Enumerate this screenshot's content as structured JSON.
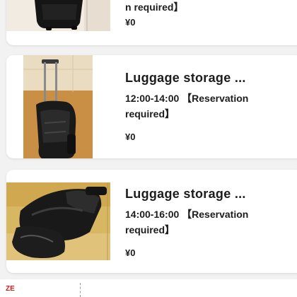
{
  "listings": [
    {
      "tail_text": "n required】",
      "price": "¥0"
    },
    {
      "title": "Luggage storage ...",
      "time": "12:00-14:00 【Reservation required】",
      "price": "¥0"
    },
    {
      "title": "Luggage storage ...",
      "time": "14:00-16:00 【Reservation required】",
      "price": "¥0"
    }
  ],
  "next_listing": {
    "logo_text": "ZE"
  },
  "colors": {
    "card": "#ffffff",
    "background": "#f2f2f2",
    "text": "#1c1c1c",
    "brand_red": "#d6171c"
  }
}
